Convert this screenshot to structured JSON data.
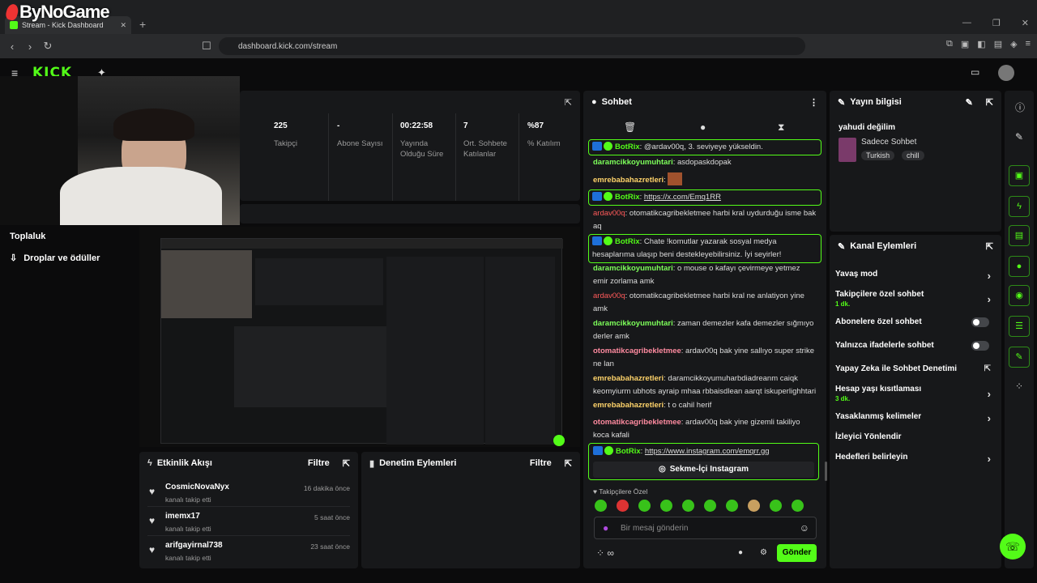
{
  "browser": {
    "tab_title": "Stream - Kick Dashboard",
    "url": "dashboard.kick.com/stream",
    "watermark": "ByNoGame"
  },
  "stats": [
    {
      "value": "225",
      "label": "Takipçi"
    },
    {
      "value": "-",
      "label": "Abone Sayısı"
    },
    {
      "value": "00:22:58",
      "label": "Yayında Olduğu Süre"
    },
    {
      "value": "7",
      "label": "Ort. Sohbete Katılanlar"
    },
    {
      "value": "%87",
      "label": "% Katılım"
    }
  ],
  "sidebar": {
    "items": [
      {
        "label": "Toplaluk"
      },
      {
        "label": "Droplar ve ödüller"
      }
    ]
  },
  "activity": {
    "title": "Etkinlik Akışı",
    "filter": "Filtre",
    "rows": [
      {
        "user": "CosmicNovaNyx",
        "action": "kanalı takip etti",
        "time": "16 dakika önce"
      },
      {
        "user": "imemx17",
        "action": "kanalı takip etti",
        "time": "5 saat önce"
      },
      {
        "user": "arifgayirnal738",
        "action": "kanalı takip etti",
        "time": "23 saat önce"
      }
    ]
  },
  "moderation": {
    "title": "Denetim Eylemleri",
    "filter": "Filtre"
  },
  "chat": {
    "title": "Sohbet",
    "messages": [
      {
        "type": "bot",
        "user": "BotRix",
        "text": "@ardav00q, 3. seviyeye yükseldin."
      },
      {
        "type": "user",
        "user": "daramcikkoyumuhtari",
        "text": "asdopaskdopak"
      },
      {
        "type": "user",
        "user": "emrebabahazretleri",
        "text": ""
      },
      {
        "type": "bot",
        "user": "BotRix",
        "text": "https://x.com/Emq1RR"
      },
      {
        "type": "user",
        "user": "ardav00q",
        "text": "otomatikcagribekletmee harbi kral uydurduğu isme bak aq"
      },
      {
        "type": "bot",
        "user": "BotRix",
        "text": "Chate !komutlar yazarak sosyal medya hesaplarıma ulaşıp beni destekleyebilirsiniz. İyi seyirler!"
      },
      {
        "type": "user",
        "user": "daramcikkoyumuhtari",
        "text": "o mouse o kafayı çevirmeye yetmez emir zorlama amk"
      },
      {
        "type": "user",
        "user": "ardav00q",
        "text": "otomatikcagribekletmee harbi kral ne anlatiyon yine amk"
      },
      {
        "type": "user",
        "user": "daramcikkoyumuhtari",
        "text": "zaman demezler kafa demezler sığmıyo derler amk"
      },
      {
        "type": "user",
        "user": "otomatikcagribekletmee",
        "text": "ardav00q bak yine sallıyo super strike ne lan"
      },
      {
        "type": "user",
        "user": "emrebabahazretleri",
        "text": "daramcikkoyumuharbdiadreanm caiqk keomyiurm ubhots ayraip mhaa rbbaisdlean aarqt iskuperlighhtari"
      },
      {
        "type": "user",
        "user": "emrebabahazretleri",
        "text": "t o cahil herif"
      },
      {
        "type": "user",
        "user": "otomatikcagribekletmee",
        "text": "ardav00q bak yine gizemli takiliyo koca kafali"
      },
      {
        "type": "bot",
        "user": "BotRix",
        "text": "https://www.instagram.com/emqrr.gg"
      }
    ],
    "instagram_button": "Sekme-İçi Instagram",
    "followers_only": "Takipçilere Özel",
    "input_placeholder": "Bir mesaj gönderin",
    "send": "Gönder",
    "infinity": "∞"
  },
  "stream_info": {
    "title": "Yayın bilgisi",
    "stream_title": "yahudi değilim",
    "category": "Sadece Sohbet",
    "tags": [
      "Turkish",
      "chill"
    ]
  },
  "channel_actions": {
    "title": "Kanal Eylemleri",
    "items": [
      {
        "label": "Yavaş mod",
        "sub": "",
        "kind": "chevron"
      },
      {
        "label": "Takipçilere özel sohbet",
        "sub": "1 dk.",
        "kind": "chevron"
      },
      {
        "label": "Abonelere özel sohbet",
        "sub": "",
        "kind": "toggle"
      },
      {
        "label": "Yalnızca ifadelerle sohbet",
        "sub": "",
        "kind": "toggle"
      },
      {
        "label": "Yapay Zeka ile Sohbet Denetimi",
        "sub": "",
        "kind": "external"
      },
      {
        "label": "Hesap yaşı kısıtlaması",
        "sub": "3 dk.",
        "kind": "chevron"
      },
      {
        "label": "Yasaklanmış kelimeler",
        "sub": "",
        "kind": "chevron"
      },
      {
        "label": "İzleyici Yönlendir",
        "sub": "",
        "kind": "none"
      },
      {
        "label": "Hedefleri belirleyin",
        "sub": "",
        "kind": "chevron"
      }
    ]
  },
  "colors": {
    "accent": "#53fc18",
    "panel": "#17181a",
    "bg": "#0b0b0c"
  }
}
